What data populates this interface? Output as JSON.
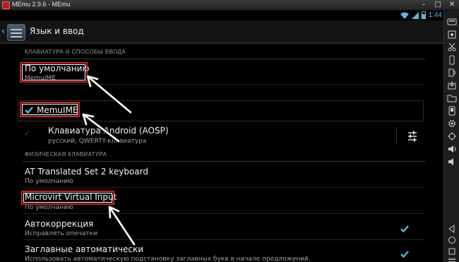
{
  "window": {
    "title": "MEmu 2.9.6 - MEmu",
    "controls": [
      "–",
      "□",
      "✕"
    ]
  },
  "statusbar": {
    "time": "1:44"
  },
  "actionbar": {
    "title": "Язык и ввод"
  },
  "sections": {
    "keyboard": "КЛАВИАТУРА И СПОСОБЫ ВВОДА",
    "physical": "ФИЗИЧЕСКАЯ КЛАВИАТУРА"
  },
  "items": {
    "default": {
      "title": "По умолчанию",
      "subtitle": "MemuIME"
    },
    "memuime": {
      "title": "MemuIME",
      "checked": true
    },
    "aosp": {
      "title": "Клавиатура Android (AOSP)",
      "subtitle": "русский, QWERTY-клавиатура"
    },
    "at_keyboard": {
      "title": "AT Translated Set 2 keyboard",
      "subtitle": "По умолчанию"
    },
    "microvirt": {
      "title": "Microvirt Virtual Input",
      "subtitle": "По умолчанию"
    },
    "autocorrect": {
      "title": "Автокоррекция",
      "subtitle": "Исправлять опечатки",
      "checked": true
    },
    "autocaps": {
      "title": "Заглавные автоматически",
      "subtitle": "Использовать автоматическую подстановку заглавных букв в начале предложений.",
      "checked": true
    }
  },
  "colors": {
    "accent": "#5ab8d8",
    "highlight": "#c42424",
    "background": "#000000"
  },
  "sidebar_icons": [
    "keyboard-icon",
    "screenshot-icon",
    "cut-icon",
    "shake-icon",
    "rotate-icon",
    "apk-icon",
    "folder-icon",
    "phone-icon",
    "settings-icon",
    "location-icon",
    "volume-up-icon",
    "volume-down-icon",
    "back-icon",
    "home-icon",
    "recent-apps-icon",
    "menu-icon"
  ]
}
